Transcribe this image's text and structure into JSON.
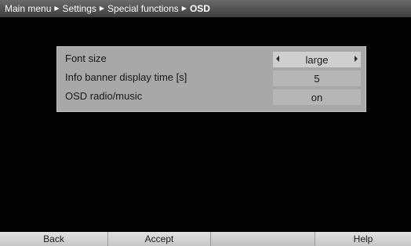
{
  "breadcrumb": {
    "items": [
      "Main menu",
      "Settings",
      "Special functions",
      "OSD"
    ]
  },
  "settings": {
    "rows": [
      {
        "label": "Font size",
        "value": "large"
      },
      {
        "label": "Info banner display time [s]",
        "value": "5"
      },
      {
        "label": "OSD radio/music",
        "value": "on"
      }
    ]
  },
  "function_keys": {
    "back": "Back",
    "accept": "Accept",
    "blank": "",
    "help": "Help"
  },
  "colors": {
    "background": "#020202",
    "panel": "#a8a8a8",
    "title_bar": "#4a4a4a",
    "button_bar": "#cfcfcf"
  },
  "icons": {
    "breadcrumb_separator": "triangle-right-icon",
    "value_prev": "triangle-left-icon",
    "value_next": "triangle-right-icon"
  }
}
